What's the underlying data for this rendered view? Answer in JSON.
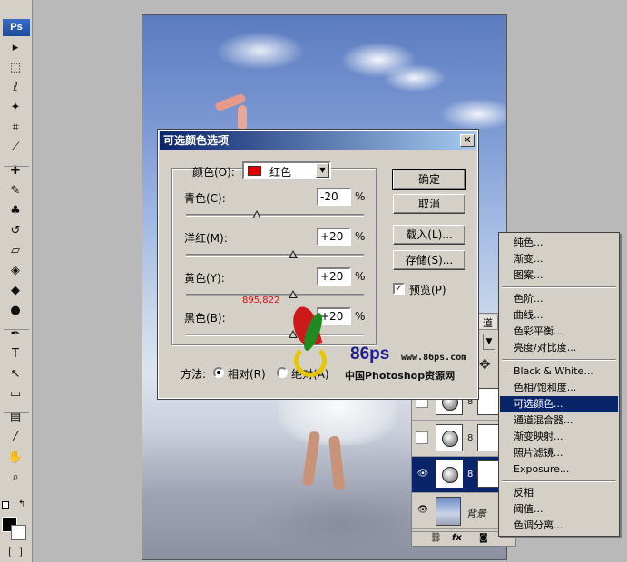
{
  "toolbox": {
    "logo": "Ps",
    "tools": [
      {
        "name": "move-tool-icon",
        "glyph": "▸"
      },
      {
        "name": "marquee-tool-icon",
        "glyph": "⬚"
      },
      {
        "name": "lasso-tool-icon",
        "glyph": "ℓ"
      },
      {
        "name": "magic-wand-tool-icon",
        "glyph": "✦"
      },
      {
        "name": "crop-tool-icon",
        "glyph": "⌗"
      },
      {
        "name": "slice-tool-icon",
        "glyph": "⟋"
      },
      {
        "name": "healing-brush-tool-icon",
        "glyph": "✚"
      },
      {
        "name": "brush-tool-icon",
        "glyph": "✎"
      },
      {
        "name": "clone-stamp-tool-icon",
        "glyph": "♣"
      },
      {
        "name": "history-brush-tool-icon",
        "glyph": "↺"
      },
      {
        "name": "eraser-tool-icon",
        "glyph": "▱"
      },
      {
        "name": "paint-bucket-tool-icon",
        "glyph": "◈"
      },
      {
        "name": "blur-tool-icon",
        "glyph": "◆"
      },
      {
        "name": "dodge-tool-icon",
        "glyph": "●"
      },
      {
        "name": "pen-tool-icon",
        "glyph": "✒"
      },
      {
        "name": "type-tool-icon",
        "glyph": "T"
      },
      {
        "name": "path-selection-tool-icon",
        "glyph": "↖"
      },
      {
        "name": "shape-tool-icon",
        "glyph": "▭"
      },
      {
        "name": "notes-tool-icon",
        "glyph": "▤"
      },
      {
        "name": "eyedropper-tool-icon",
        "glyph": "⁄"
      },
      {
        "name": "hand-tool-icon",
        "glyph": "✋"
      },
      {
        "name": "zoom-tool-icon",
        "glyph": "⌕"
      }
    ]
  },
  "dialog": {
    "title": "可选颜色选项",
    "close_glyph": "✕",
    "color_label": "颜色(O):",
    "color_value": "红色",
    "color_swatch": "#e20000",
    "dropdown_glyph": "▼",
    "sliders": [
      {
        "label": "青色(C):",
        "value": "-20",
        "unit": "%",
        "level": -20
      },
      {
        "label": "洋红(M):",
        "value": "+20",
        "unit": "%",
        "level": 20
      },
      {
        "label": "黄色(Y):",
        "value": "+20",
        "unit": "%",
        "level": 20
      },
      {
        "label": "黑色(B):",
        "value": "+20",
        "unit": "%",
        "level": 20
      }
    ],
    "ok_label": "确定",
    "cancel_label": "取消",
    "load_label": "载入(L)...",
    "save_label": "存储(S)...",
    "preview_label": "预览(P)",
    "preview_checked": true,
    "check_glyph": "✓",
    "method_label": "方法:",
    "method_relative": "相对(R)",
    "method_absolute": "绝对(A)",
    "method_selected": "relative",
    "coord_text": "895,822"
  },
  "layers": {
    "tab_label": "道",
    "background_label": "背景",
    "eye_glyph": "👁",
    "link_glyph": "8",
    "footer_fx": "fx",
    "scroll_glyph": "▼",
    "move_glyph": "✥"
  },
  "menu": {
    "items": [
      {
        "label": "纯色...",
        "sep_after": false
      },
      {
        "label": "渐变...",
        "sep_after": false
      },
      {
        "label": "图案...",
        "sep_after": true
      },
      {
        "label": "色阶...",
        "sep_after": false
      },
      {
        "label": "曲线...",
        "sep_after": false
      },
      {
        "label": "色彩平衡...",
        "sep_after": false
      },
      {
        "label": "亮度/对比度...",
        "sep_after": true
      },
      {
        "label": "Black & White...",
        "sep_after": false
      },
      {
        "label": "色相/饱和度...",
        "sep_after": false
      },
      {
        "label": "可选颜色...",
        "sep_after": false,
        "highlighted": true
      },
      {
        "label": "通道混合器...",
        "sep_after": false
      },
      {
        "label": "渐变映射...",
        "sep_after": false
      },
      {
        "label": "照片滤镜...",
        "sep_after": false
      },
      {
        "label": "Exposure...",
        "sep_after": true
      },
      {
        "label": "反相",
        "sep_after": false
      },
      {
        "label": "阈值...",
        "sep_after": false
      },
      {
        "label": "色调分离...",
        "sep_after": false
      }
    ]
  },
  "watermark": {
    "brand": "86ps",
    "url": "www.86ps.com",
    "cn": "中国Photoshop资源网"
  }
}
